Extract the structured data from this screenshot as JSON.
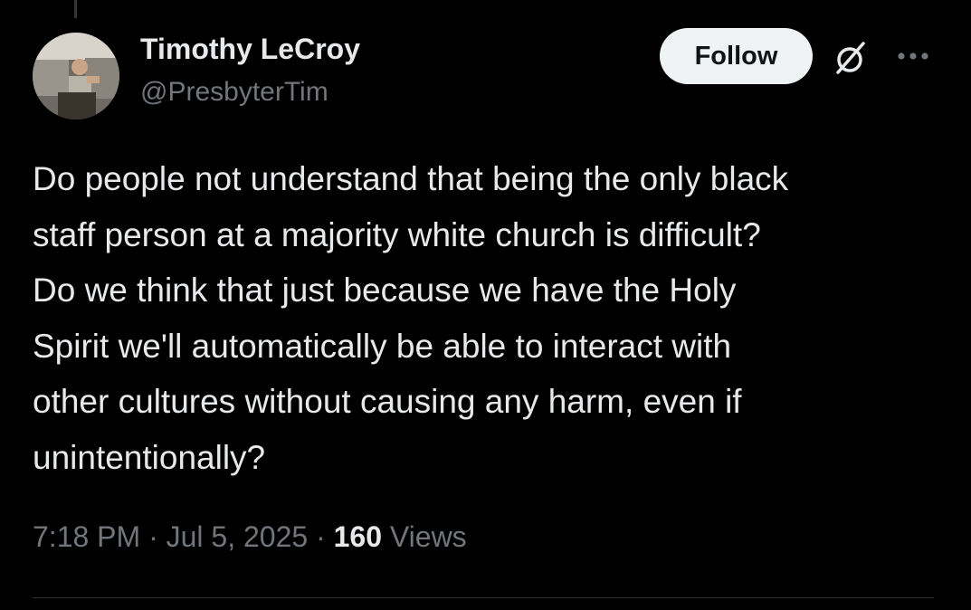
{
  "author": {
    "name": "Timothy LeCroy",
    "handle": "@PresbyterTim"
  },
  "follow_button": {
    "label": "Follow"
  },
  "icons": {
    "grok": "grok-icon",
    "more": "more-options-icon",
    "avatar": "profile-photo"
  },
  "tweet": {
    "text": "Do people not understand that being the only black\nstaff person at a majority white church is difficult?\nDo we think that just because we have the Holy\nSpirit we'll automatically be able to interact with\nother cultures without causing any harm, even if\nunintentionally?",
    "time": "7:18 PM",
    "date": "Jul 5, 2025",
    "separator": "·",
    "views_count": "160",
    "views_label": "Views"
  },
  "colors": {
    "background": "#000000",
    "primary_text": "#e7e9ea",
    "secondary_text": "#71767b",
    "follow_bg": "#eff3f4",
    "follow_text": "#0f1419",
    "divider": "#2f3336"
  }
}
